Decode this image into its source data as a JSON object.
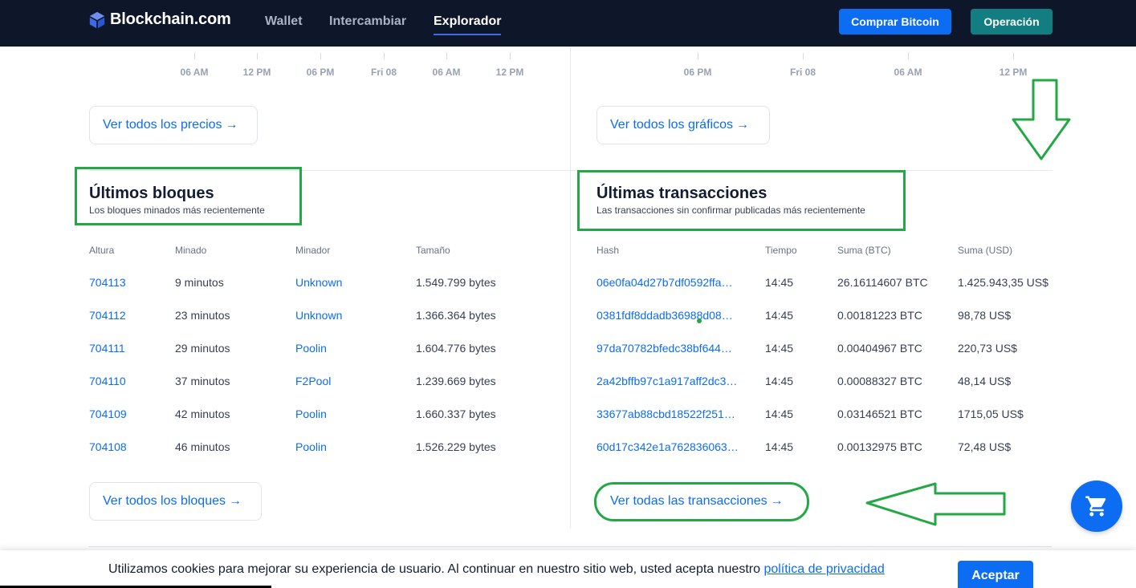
{
  "header": {
    "logo_text": "Blockchain.com",
    "nav": [
      "Wallet",
      "Intercambiar",
      "Explorador"
    ],
    "active_nav": "Explorador",
    "buy_label": "Comprar Bitcoin",
    "trade_label": "Operación",
    "colors": {
      "bg": "#0e1729",
      "buy": "#0c6cf2",
      "trade": "#137e82"
    }
  },
  "price_chart": {
    "ticks": [
      "06 AM",
      "12 PM",
      "06 PM",
      "Fri 08",
      "06 AM",
      "12 PM"
    ],
    "button": "Ver todos los precios"
  },
  "charts_chart": {
    "ticks": [
      "06 PM",
      "Fri 08",
      "06 AM",
      "12 PM"
    ],
    "button": "Ver todos los gráficos"
  },
  "blocks": {
    "title": "Últimos bloques",
    "subtitle": "Los bloques minados más recientemente",
    "columns": [
      "Altura",
      "Minado",
      "Minador",
      "Tamaño"
    ],
    "rows": [
      {
        "height": "704113",
        "mined": "9 minutos",
        "miner": "Unknown",
        "size": "1.549.799 bytes"
      },
      {
        "height": "704112",
        "mined": "23 minutos",
        "miner": "Unknown",
        "size": "1.366.364 bytes"
      },
      {
        "height": "704111",
        "mined": "29 minutos",
        "miner": "Poolin",
        "size": "1.604.776 bytes"
      },
      {
        "height": "704110",
        "mined": "37 minutos",
        "miner": "F2Pool",
        "size": "1.239.669 bytes"
      },
      {
        "height": "704109",
        "mined": "42 minutos",
        "miner": "Poolin",
        "size": "1.660.337 bytes"
      },
      {
        "height": "704108",
        "mined": "46 minutos",
        "miner": "Poolin",
        "size": "1.526.229 bytes"
      }
    ],
    "button": "Ver todos los bloques"
  },
  "transactions": {
    "title": "Últimas transacciones",
    "subtitle": "Las transacciones sin confirmar publicadas más recientemente",
    "columns": [
      "Hash",
      "Tiempo",
      "Suma (BTC)",
      "Suma (USD)"
    ],
    "rows": [
      {
        "hash": "06e0fa04d27b7df0592ffa…",
        "time": "14:45",
        "btc": "26.16114607 BTC",
        "usd": "1.425.943,35 US$"
      },
      {
        "hash": "0381fdf8ddadb36988d08…",
        "time": "14:45",
        "btc": "0.00181223 BTC",
        "usd": "98,78 US$"
      },
      {
        "hash": "97da70782bfedc38bf644…",
        "time": "14:45",
        "btc": "0.00404967 BTC",
        "usd": "220,73 US$"
      },
      {
        "hash": "2a42bffb97c1a917aff2dc3…",
        "time": "14:45",
        "btc": "0.00088327 BTC",
        "usd": "48,14 US$"
      },
      {
        "hash": "33677ab88cbd18522f251…",
        "time": "14:45",
        "btc": "0.03146521 BTC",
        "usd": "1715,05 US$"
      },
      {
        "hash": "60d17c342e1a762836063…",
        "time": "14:45",
        "btc": "0.00132975 BTC",
        "usd": "72,48 US$"
      }
    ],
    "button": "Ver todas las transacciones"
  },
  "cookie": {
    "text": "Utilizamos cookies para mejorar su experiencia de usuario. Al continuar en nuestro sitio web, usted acepta nuestro ",
    "link": "política de privacidad",
    "accept": "Aceptar"
  },
  "arrow_glyph": "→",
  "icons": {
    "logo": "blockchain-logo-icon",
    "cart": "shopping-cart-icon"
  },
  "annotation_color": "#23a845"
}
